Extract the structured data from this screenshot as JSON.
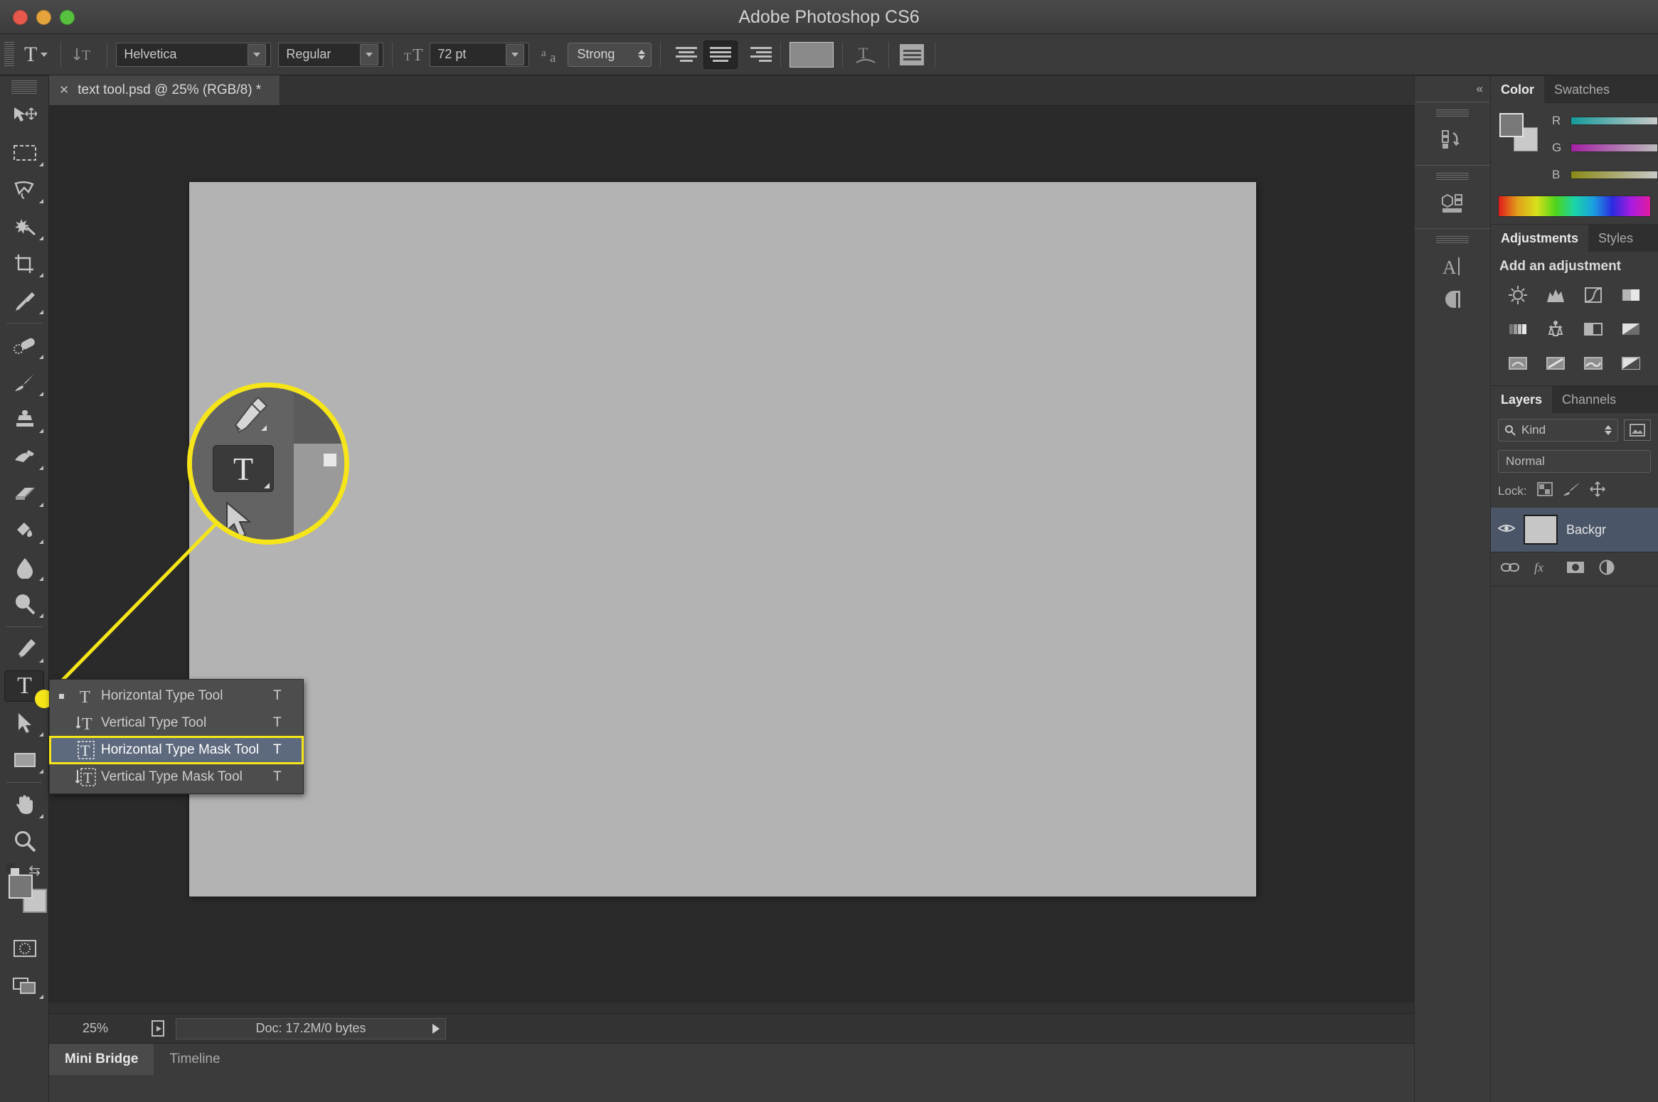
{
  "window": {
    "title": "Adobe Photoshop CS6",
    "traffic_lights": [
      "close",
      "minimize",
      "zoom"
    ]
  },
  "options_bar": {
    "tool_icon": "type-tool-icon",
    "tool_preset_caret": "chevron-down-icon",
    "orientation_icon": "toggle-text-orientation-icon",
    "font_family": "Helvetica",
    "font_style": "Regular",
    "font_size_icon": "font-size-icon",
    "font_size": "72 pt",
    "antialias_icon": "anti-aliasing-icon",
    "antialias_method": "Strong",
    "align_left": "align-left-icon",
    "align_center": "align-center-icon",
    "align_right": "align-right-icon",
    "align_active": "center",
    "text_color": "#8a8a8a",
    "warp_icon": "warp-text-icon",
    "panels_icon": "character-paragraph-panels-icon",
    "dropdown_caret": "chevron-down-icon"
  },
  "toolbar": {
    "tools": [
      {
        "name": "move-tool",
        "icon": "move-tool-icon",
        "has_flyout": false,
        "selected": false
      },
      {
        "name": "rectangular-marquee-tool",
        "icon": "marquee-icon",
        "has_flyout": true,
        "selected": false
      },
      {
        "name": "lasso-tool",
        "icon": "lasso-icon",
        "has_flyout": true,
        "selected": false
      },
      {
        "name": "quick-selection-tool",
        "icon": "magic-wand-icon",
        "has_flyout": true,
        "selected": false
      },
      {
        "name": "crop-tool",
        "icon": "crop-icon",
        "has_flyout": true,
        "selected": false
      },
      {
        "name": "eyedropper-tool",
        "icon": "eyedropper-icon",
        "has_flyout": true,
        "selected": false
      },
      {
        "name": "spot-healing-brush-tool",
        "icon": "healing-brush-icon",
        "has_flyout": true,
        "selected": false
      },
      {
        "name": "brush-tool",
        "icon": "brush-icon",
        "has_flyout": true,
        "selected": false
      },
      {
        "name": "clone-stamp-tool",
        "icon": "clone-stamp-icon",
        "has_flyout": true,
        "selected": false
      },
      {
        "name": "history-brush-tool",
        "icon": "history-brush-icon",
        "has_flyout": true,
        "selected": false
      },
      {
        "name": "eraser-tool",
        "icon": "eraser-icon",
        "has_flyout": true,
        "selected": false
      },
      {
        "name": "gradient-tool",
        "icon": "paint-bucket-icon",
        "has_flyout": true,
        "selected": false
      },
      {
        "name": "blur-tool",
        "icon": "blur-droplet-icon",
        "has_flyout": true,
        "selected": false
      },
      {
        "name": "dodge-tool",
        "icon": "dodge-icon",
        "has_flyout": true,
        "selected": false
      },
      {
        "name": "pen-tool",
        "icon": "pen-icon",
        "has_flyout": true,
        "selected": false
      },
      {
        "name": "type-tool",
        "icon": "type-tool-icon",
        "has_flyout": true,
        "selected": true
      },
      {
        "name": "path-selection-tool",
        "icon": "path-arrow-icon",
        "has_flyout": true,
        "selected": false
      },
      {
        "name": "rectangle-tool",
        "icon": "rectangle-shape-icon",
        "has_flyout": true,
        "selected": false
      },
      {
        "name": "hand-tool",
        "icon": "hand-icon",
        "has_flyout": true,
        "selected": false
      },
      {
        "name": "zoom-tool",
        "icon": "magnifier-icon",
        "has_flyout": false,
        "selected": false
      }
    ],
    "foreground_color": "#767676",
    "background_color": "#c6c6c6",
    "default_colors_icon": "default-colors-icon",
    "swap_colors_icon": "swap-colors-icon",
    "quick_mask_icon": "quick-mask-icon",
    "screen_mode_icon": "screen-mode-icon"
  },
  "flyout_menu": {
    "items": [
      {
        "label": "Horizontal Type Tool",
        "shortcut": "T",
        "icon": "horizontal-type-icon",
        "active": false,
        "current": true
      },
      {
        "label": "Vertical Type Tool",
        "shortcut": "T",
        "icon": "vertical-type-icon",
        "active": false,
        "current": false
      },
      {
        "label": "Horizontal Type Mask Tool",
        "shortcut": "T",
        "icon": "horizontal-type-mask-icon",
        "active": true,
        "current": false
      },
      {
        "label": "Vertical Type Mask Tool",
        "shortcut": "T",
        "icon": "vertical-type-mask-icon",
        "active": false,
        "current": false
      }
    ],
    "highlight_color": "#f5e519",
    "selected_row_color": "#5d6a7e"
  },
  "document": {
    "tab_label": "text tool.psd @ 25% (RGB/8) *",
    "close_icon": "close-icon",
    "canvas_color": "#b3b3b3"
  },
  "status_bar": {
    "zoom": "25%",
    "doc_icon": "document-icon",
    "doc_info": "Doc: 17.2M/0 bytes",
    "expand_icon": "play-arrow-icon"
  },
  "bottom_dock": {
    "tabs": [
      {
        "label": "Mini Bridge",
        "active": true
      },
      {
        "label": "Timeline",
        "active": false
      }
    ],
    "menu_icon": "panel-menu-icon"
  },
  "collapse_strip": {
    "collapse_icon": "double-chevron-right-icon",
    "groups": [
      {
        "icons": [
          "history-panel-icon"
        ]
      },
      {
        "icons": [
          "3d-panel-icon"
        ]
      },
      {
        "icons": [
          "character-panel-icon",
          "paragraph-panel-icon"
        ]
      }
    ]
  },
  "color_panel": {
    "tabs": [
      {
        "label": "Color",
        "active": true
      },
      {
        "label": "Swatches",
        "active": false
      }
    ],
    "foreground": "#787878",
    "background": "#c9c9c9",
    "channels": [
      {
        "label": "R"
      },
      {
        "label": "G"
      },
      {
        "label": "B"
      }
    ],
    "spectrum_icon": "color-spectrum-ramp"
  },
  "adjustments_panel": {
    "tabs": [
      {
        "label": "Adjustments",
        "active": true
      },
      {
        "label": "Styles",
        "active": false
      }
    ],
    "heading": "Add an adjustment",
    "icons": [
      "brightness-contrast-icon",
      "levels-icon",
      "curves-icon",
      "exposure-icon",
      "vibrance-icon",
      "hue-saturation-icon",
      "color-balance-icon",
      "black-white-icon",
      "photo-filter-icon",
      "channel-mixer-icon",
      "color-lookup-icon",
      "invert-icon"
    ]
  },
  "layers_panel": {
    "tabs": [
      {
        "label": "Layers",
        "active": true
      },
      {
        "label": "Channels",
        "active": false
      }
    ],
    "filter_label": "Kind",
    "filter_icon": "search-icon",
    "thumb_toggle_icon": "filter-thumbnail-icon",
    "blend_mode": "Normal",
    "lock_label": "Lock:",
    "lock_icons": [
      "lock-transparency-icon",
      "lock-pixels-icon",
      "lock-position-icon"
    ],
    "rows": [
      {
        "name": "Backgr",
        "visible": true,
        "visibility_icon": "eye-icon",
        "selected": true
      }
    ],
    "footer_icons": [
      "link-layers-icon",
      "layer-style-fx-icon",
      "layer-mask-icon",
      "adjustment-layer-icon"
    ]
  },
  "callout": {
    "highlight_color": "#f5e519",
    "magnified_tool": "type-tool-icon",
    "above_tool": "pen-tool-icon",
    "below_tool": "path-selection-tool-icon",
    "anchor_label": "type-tool-in-toolbar"
  }
}
